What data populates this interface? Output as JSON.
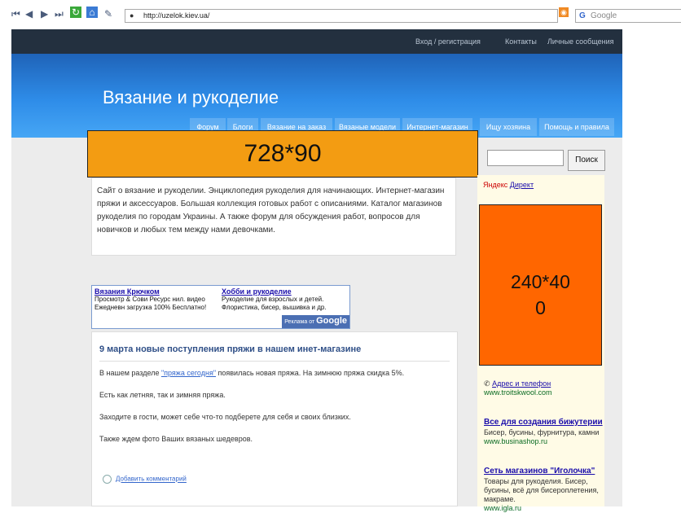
{
  "browser": {
    "url": "http://uzelok.kiev.ua/",
    "search_placeholder": "Google"
  },
  "header": {
    "top_links": [
      "Вход / регистрация",
      "Контакты",
      "Личные сообщения"
    ],
    "site_title": "Вязание и рукоделие",
    "nav": [
      "Форум",
      "Блоги",
      "Вязание на заказ",
      "Вязаные модели",
      "Интернет-магазин",
      "Ищу хозяина",
      "Помощь и правила"
    ]
  },
  "ads": {
    "leaderboard": "728*90",
    "skyscraper_line1": "240*40",
    "skyscraper_line2": "0"
  },
  "intro": "Сайт о вязание и рукоделии. Энциклопедия рукоделия для начинающих. Интернет-магазин пряжи и аксессуаров. Большая коллекция готовых работ с описаниями. Каталог магазинов рукоделия по городам Украины. А также форум для обсуждения работ, вопросов для новичков и любых тем между нами девочками.",
  "google_ads": [
    {
      "title": "Вязания Крючком",
      "line1": "Просмотр & Сови Ресурс нил. видео",
      "line2": "Ежедневн загрузка 100% Бесплатно!"
    },
    {
      "title": "Хобби и рукоделие",
      "line1": "Рукоделие для взрослых и детей.",
      "line2": "Флористика, бисер, вышивка и др."
    }
  ],
  "google_footer_prefix": "Реклама от",
  "google_footer_brand": "Google",
  "post": {
    "title": "9 марта новые поступления пряжи в нашем инет-магазине",
    "p1_before": "В нашем разделе ",
    "p1_link": "\"пряжа сегодня\"",
    "p1_after": " появилась новая пряжа. На зимнюю пряжа скидка 5%.",
    "p2": "Есть как летняя, так и зимняя пряжа.",
    "p3": "Заходите в гости, может себе что-то подберете для себя и своих близких.",
    "p4": "Также ждем фото Ваших вязаных шедевров.",
    "comment_link": "Добавить комментарий"
  },
  "sidebar": {
    "search_button": "Поиск",
    "yandex": "Яндекс",
    "direct": "Директ",
    "ads": [
      {
        "title": "",
        "text": "Адрес и телефон",
        "url": "www.troitskwool.com"
      },
      {
        "title": "Все для создания бижутерии",
        "text": "Бисер, бусины, фурнитура, камни",
        "url": "www.businashop.ru"
      },
      {
        "title": "Сеть магазинов \"Иголочка\"",
        "text": "Товары для рукоделия. Бисер, бусины, всё для бисероплетения, макраме.",
        "url": "www.igla.ru"
      }
    ]
  },
  "colors": {
    "banner": "#2e8ce8",
    "ad_orange": "#f39c12",
    "ad_red_orange": "#ff6600",
    "sidebar_bg": "#fffbe6"
  }
}
